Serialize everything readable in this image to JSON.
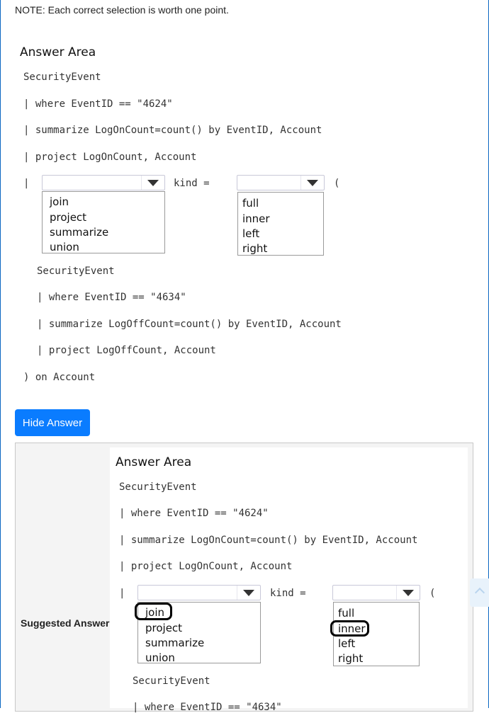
{
  "note": "NOTE: Each correct selection is worth one point.",
  "answer_area_title": "Answer Area",
  "code": {
    "line1": "SecurityEvent",
    "line2": "| where EventID == \"4624\"",
    "line3": "| summarize LogOnCount=count() by EventID, Account",
    "line4": "| project LogOnCount, Account",
    "pipe": "|",
    "kind": "kind =",
    "paren_open": "(",
    "line6": "SecurityEvent",
    "line7": "| where EventID == \"4634\"",
    "line8": "| summarize LogOffCount=count() by EventID, Account",
    "line9": "| project LogOffCount, Account",
    "line10": ") on Account"
  },
  "dropdown1": {
    "options": [
      "join",
      "project",
      "summarize",
      "union"
    ]
  },
  "dropdown2": {
    "options": [
      "full",
      "inner",
      "left",
      "right"
    ]
  },
  "hide_button": "Hide Answer",
  "suggested_label": "Suggested Answer:",
  "suggested": {
    "selected_operator": "join",
    "selected_kind": "inner"
  }
}
